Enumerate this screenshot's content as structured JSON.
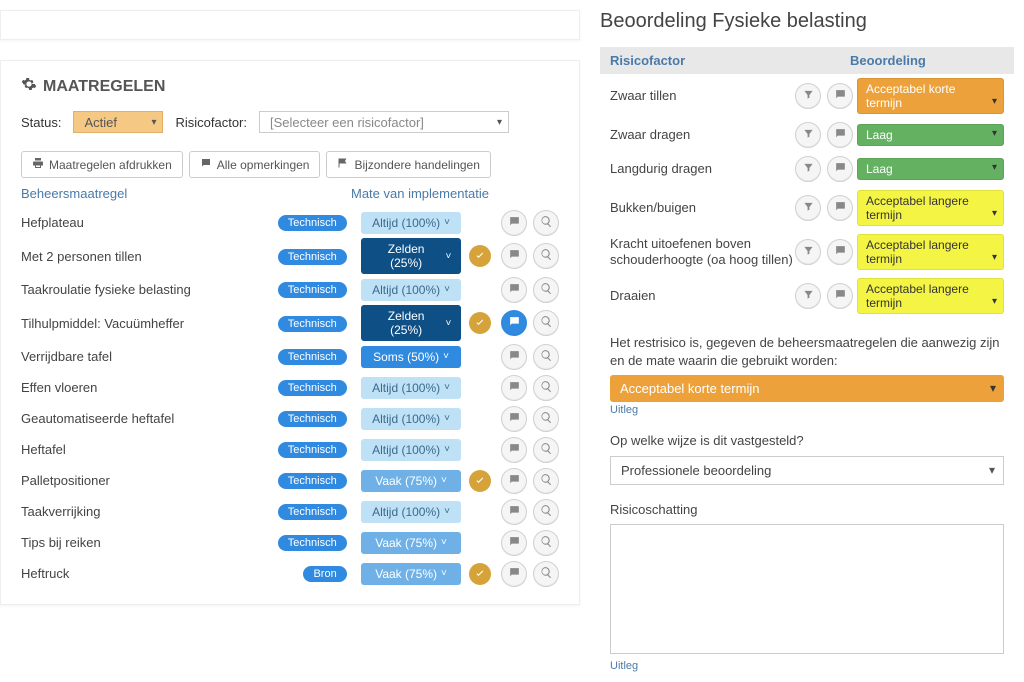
{
  "left": {
    "section_title": "MAATREGELEN",
    "filters": {
      "status_label": "Status:",
      "status_value": "Actief",
      "risk_label": "Risicofactor:",
      "risk_value": "[Selecteer een risicofactor]"
    },
    "toolbar": {
      "print": "Maatregelen afdrukken",
      "all_comments": "Alle opmerkingen",
      "special_actions": "Bijzondere handelingen"
    },
    "columns": {
      "name": "Beheersmaatregel",
      "impl": "Mate van implementatie"
    },
    "tags": {
      "tech": "Technisch",
      "bron": "Bron"
    },
    "rows": [
      {
        "name": "Hefplateau",
        "tag": "tech",
        "impl": "Altijd (100%)",
        "style": "light",
        "check": false,
        "comment_active": false
      },
      {
        "name": "Met 2 personen tillen",
        "tag": "tech",
        "impl": "Zelden (25%)",
        "style": "dark",
        "check": true,
        "comment_active": false
      },
      {
        "name": "Taakroulatie fysieke belasting",
        "tag": "tech",
        "impl": "Altijd (100%)",
        "style": "light",
        "check": false,
        "comment_active": false
      },
      {
        "name": "Tilhulpmiddel: Vacuümheffer",
        "tag": "tech",
        "impl": "Zelden (25%)",
        "style": "dark",
        "check": true,
        "comment_active": true
      },
      {
        "name": "Verrijdbare tafel",
        "tag": "tech",
        "impl": "Soms (50%)",
        "style": "mid",
        "check": false,
        "comment_active": false
      },
      {
        "name": "Effen vloeren",
        "tag": "tech",
        "impl": "Altijd (100%)",
        "style": "light",
        "check": false,
        "comment_active": false
      },
      {
        "name": "Geautomatiseerde heftafel",
        "tag": "tech",
        "impl": "Altijd (100%)",
        "style": "light",
        "check": false,
        "comment_active": false
      },
      {
        "name": "Heftafel",
        "tag": "tech",
        "impl": "Altijd (100%)",
        "style": "light",
        "check": false,
        "comment_active": false
      },
      {
        "name": "Palletpositioner",
        "tag": "tech",
        "impl": "Vaak (75%)",
        "style": "mid2",
        "check": true,
        "comment_active": false
      },
      {
        "name": "Taakverrijking",
        "tag": "tech",
        "impl": "Altijd (100%)",
        "style": "light",
        "check": false,
        "comment_active": false
      },
      {
        "name": "Tips bij reiken",
        "tag": "tech",
        "impl": "Vaak (75%)",
        "style": "mid2",
        "check": false,
        "comment_active": false
      },
      {
        "name": "Heftruck",
        "tag": "bron",
        "impl": "Vaak (75%)",
        "style": "mid2",
        "check": true,
        "comment_active": false
      }
    ]
  },
  "right": {
    "title": "Beoordeling Fysieke belasting",
    "header": {
      "risk": "Risicofactor",
      "rating": "Beoordeling"
    },
    "rows": [
      {
        "name": "Zwaar tillen",
        "value": "Acceptabel korte termijn",
        "color": "orange"
      },
      {
        "name": "Zwaar dragen",
        "value": "Laag",
        "color": "green"
      },
      {
        "name": "Langdurig dragen",
        "value": "Laag",
        "color": "green"
      },
      {
        "name": "Bukken/buigen",
        "value": "Acceptabel langere termijn",
        "color": "yellow"
      },
      {
        "name": "Kracht uitoefenen boven schouderhoogte (oa hoog tillen)",
        "value": "Acceptabel langere termijn",
        "color": "yellow"
      },
      {
        "name": "Draaien",
        "value": "Acceptabel langere termijn",
        "color": "yellow"
      }
    ],
    "restrisico_text": "Het restrisico is, gegeven de beheersmaatregelen die aanwezig zijn en de mate waarin die gebruikt worden:",
    "restrisico_value": "Acceptabel korte termijn",
    "uitleg": "Uitleg",
    "method_label": "Op welke wijze is dit vastgesteld?",
    "method_value": "Professionele beoordeling",
    "schatting_label": "Risicoschatting"
  }
}
